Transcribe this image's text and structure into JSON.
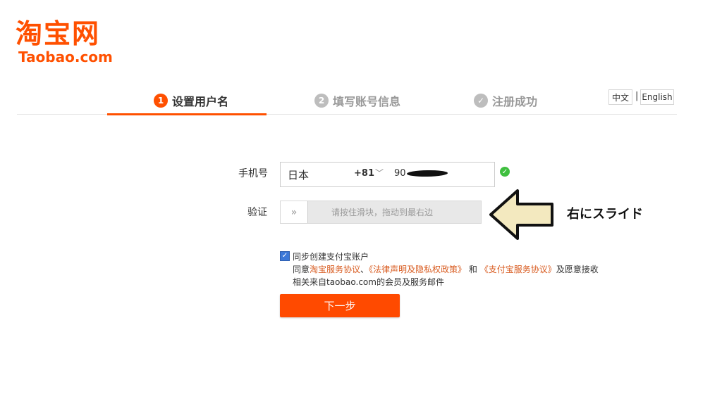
{
  "logo": {
    "cn": "淘宝网",
    "en": "Taobao.com"
  },
  "steps": [
    {
      "num": "1",
      "label": "设置用户名",
      "state": "active"
    },
    {
      "num": "2",
      "label": "填写账号信息",
      "state": "pending"
    },
    {
      "num": "✓",
      "label": "注册成功",
      "state": "pending"
    }
  ],
  "lang": {
    "cn": "中文",
    "sep": "|",
    "en": "English"
  },
  "form": {
    "phone_label": "手机号",
    "country": "日本",
    "country_code": "+81",
    "phone_value": "90",
    "verify_label": "验证",
    "slider_text": "请按住滑块，拖动到最右边",
    "slider_knob": "»"
  },
  "annotation": {
    "text": "右にスライド"
  },
  "agreement": {
    "checkbox_label": "同步创建支付宝账户",
    "prefix": "同意",
    "link1": "淘宝服务协议",
    "sep1": "、",
    "link2": "《法律声明及隐私权政策》",
    "sep2": " 和 ",
    "link3": "《支付宝服务协议》",
    "suffix": "及愿意接收",
    "line2": "相关来自taobao.com的会员及服务邮件"
  },
  "next_button": "下一步",
  "colors": {
    "brand": "#ff5000",
    "link": "#d85a1e",
    "ok": "#3fbf3f"
  }
}
